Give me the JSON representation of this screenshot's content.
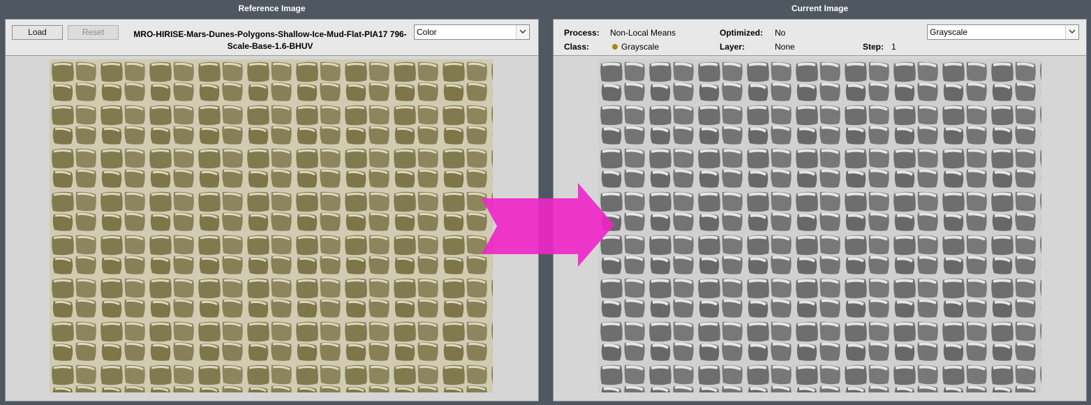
{
  "reference": {
    "title": "Reference Image",
    "load_label": "Load",
    "reset_label": "Reset",
    "filename": "MRO-HIRISE-Mars-Dunes-Polygons-Shallow-Ice-Mud-Flat-PIA17 796-Scale-Base-1.6-BHUV",
    "color_mode": "Color",
    "image_alt": "Mars polygon terrain (color)"
  },
  "current": {
    "title": "Current Image",
    "process_label": "Process:",
    "process_value": "Non-Local Means",
    "optimized_label": "Optimized:",
    "optimized_value": "No",
    "class_label": "Class:",
    "class_value": "Grayscale",
    "layer_label": "Layer:",
    "layer_value": "None",
    "step_label": "Step:",
    "step_value": "1",
    "color_mode": "Grayscale",
    "image_alt": "Mars polygon terrain (grayscale)"
  },
  "colors": {
    "background": "#4f5760",
    "panel": "#d6d6d6",
    "arrow": "#f025c8",
    "class_dot": "#a8861a"
  },
  "icons": [
    "chevron-down-icon",
    "class-dot-icon",
    "transform-arrow-icon"
  ]
}
